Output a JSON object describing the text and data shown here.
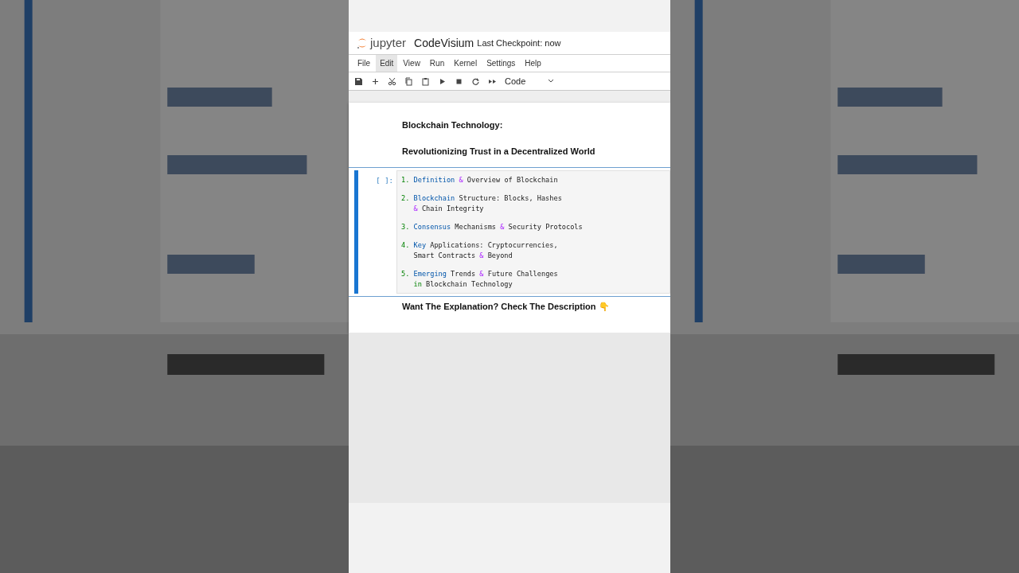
{
  "header": {
    "logo": "jupyter",
    "notebook_name": "CodeVisium",
    "checkpoint": "Last Checkpoint: now"
  },
  "menu": [
    {
      "label": "File",
      "selected": false
    },
    {
      "label": "Edit",
      "selected": true
    },
    {
      "label": "View",
      "selected": false
    },
    {
      "label": "Run",
      "selected": false
    },
    {
      "label": "Kernel",
      "selected": false
    },
    {
      "label": "Settings",
      "selected": false
    },
    {
      "label": "Help",
      "selected": false
    }
  ],
  "toolbar": {
    "cell_type": "Code"
  },
  "markdown_top": [
    "Blockchain Technology:",
    "Revolutionizing Trust in a Decentralized World"
  ],
  "code_cell": {
    "prompt": "[ ]:",
    "active": true,
    "items": [
      {
        "lines": [
          {
            "continued": false,
            "tokens": [
              {
                "kind": "number",
                "text": "1."
              },
              {
                "kind": "name",
                "text": " Definition"
              },
              {
                "kind": "op",
                "text": " &"
              },
              {
                "kind": "text",
                "text": " Overview of Blockchain"
              }
            ]
          }
        ]
      },
      {
        "lines": [
          {
            "continued": false,
            "tokens": [
              {
                "kind": "number",
                "text": "2."
              },
              {
                "kind": "name",
                "text": " Blockchain"
              },
              {
                "kind": "text",
                "text": " Structure: Blocks, Hashes"
              }
            ]
          },
          {
            "continued": true,
            "tokens": [
              {
                "kind": "op",
                "text": "&"
              },
              {
                "kind": "text",
                "text": " Chain Integrity"
              }
            ]
          }
        ]
      },
      {
        "lines": [
          {
            "continued": false,
            "tokens": [
              {
                "kind": "number",
                "text": "3."
              },
              {
                "kind": "name",
                "text": " Consensus"
              },
              {
                "kind": "text",
                "text": " Mechanisms "
              },
              {
                "kind": "op",
                "text": "&"
              },
              {
                "kind": "text",
                "text": " Security Protocols"
              }
            ]
          }
        ]
      },
      {
        "lines": [
          {
            "continued": false,
            "tokens": [
              {
                "kind": "number",
                "text": "4."
              },
              {
                "kind": "name",
                "text": " Key"
              },
              {
                "kind": "text",
                "text": " Applications: Cryptocurrencies,"
              }
            ]
          },
          {
            "continued": true,
            "tokens": [
              {
                "kind": "text",
                "text": "Smart Contracts "
              },
              {
                "kind": "op",
                "text": "&"
              },
              {
                "kind": "text",
                "text": " Beyond"
              }
            ]
          }
        ]
      },
      {
        "lines": [
          {
            "continued": false,
            "tokens": [
              {
                "kind": "number",
                "text": "5."
              },
              {
                "kind": "name",
                "text": " Emerging"
              },
              {
                "kind": "text",
                "text": " Trends "
              },
              {
                "kind": "op",
                "text": "&"
              },
              {
                "kind": "text",
                "text": " Future Challenges"
              }
            ]
          },
          {
            "continued": true,
            "tokens": [
              {
                "kind": "keyword",
                "text": "in"
              },
              {
                "kind": "text",
                "text": " Blockchain Technology"
              }
            ]
          }
        ]
      }
    ]
  },
  "markdown_bottom": "Want The Explanation? Check The Description 👇"
}
